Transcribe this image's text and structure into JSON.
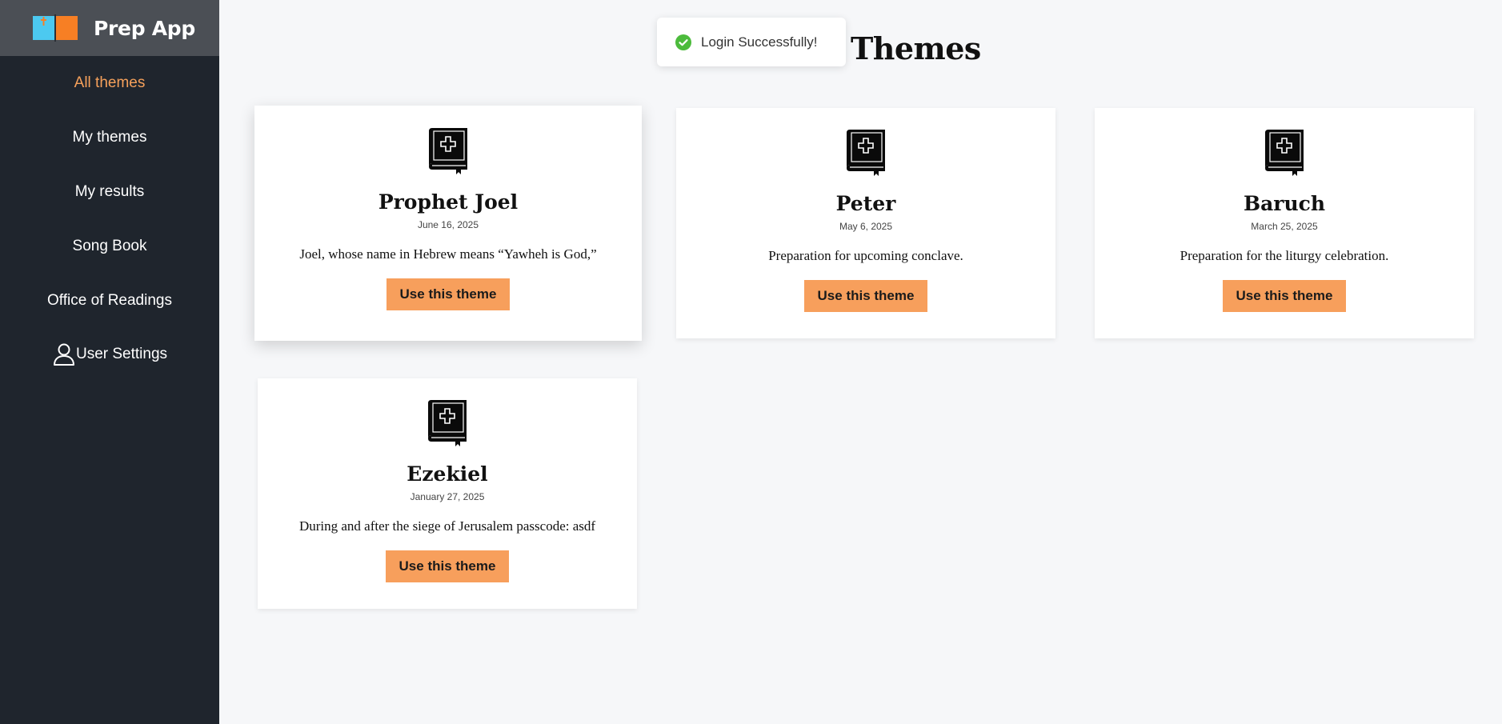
{
  "brand": {
    "title": "Prep App",
    "logo_icon": "open-book-cross-icon",
    "logo_colors": [
      "#4cc9f0",
      "#f77f24"
    ]
  },
  "sidebar": {
    "items": [
      {
        "label": "All themes",
        "active": true
      },
      {
        "label": "My themes",
        "active": false
      },
      {
        "label": "My results",
        "active": false
      },
      {
        "label": "Song Book",
        "active": false
      },
      {
        "label": "Office of Readings",
        "active": false
      },
      {
        "label": "User Settings",
        "active": false,
        "icon": "user-icon"
      }
    ],
    "active_color": "#f6a15b"
  },
  "toast": {
    "message": "Login Successfully!",
    "icon": "check-circle-icon",
    "icon_color": "#4cbb3c"
  },
  "page": {
    "title_visible": "ation Themes"
  },
  "themes": [
    {
      "title": "Prophet Joel",
      "date": "June 16, 2025",
      "description": "Joel, whose name in Hebrew means “Yawheh is God,”",
      "button": "Use this theme",
      "icon": "bible-icon"
    },
    {
      "title": "Peter",
      "date": "May 6, 2025",
      "description": "Preparation for upcoming conclave.",
      "button": "Use this theme",
      "icon": "bible-icon"
    },
    {
      "title": "Baruch",
      "date": "March 25, 2025",
      "description": "Preparation for the liturgy celebration.",
      "button": "Use this theme",
      "icon": "bible-icon"
    },
    {
      "title": "Ezekiel",
      "date": "January 27, 2025",
      "description": "During and after the siege of Jerusalem passcode: asdf",
      "button": "Use this theme",
      "icon": "bible-icon"
    }
  ],
  "colors": {
    "sidebar_bg": "#1f252d",
    "brand_bg": "#4b4f55",
    "button_bg": "#f79f5c",
    "page_bg": "#f6f7f9"
  }
}
